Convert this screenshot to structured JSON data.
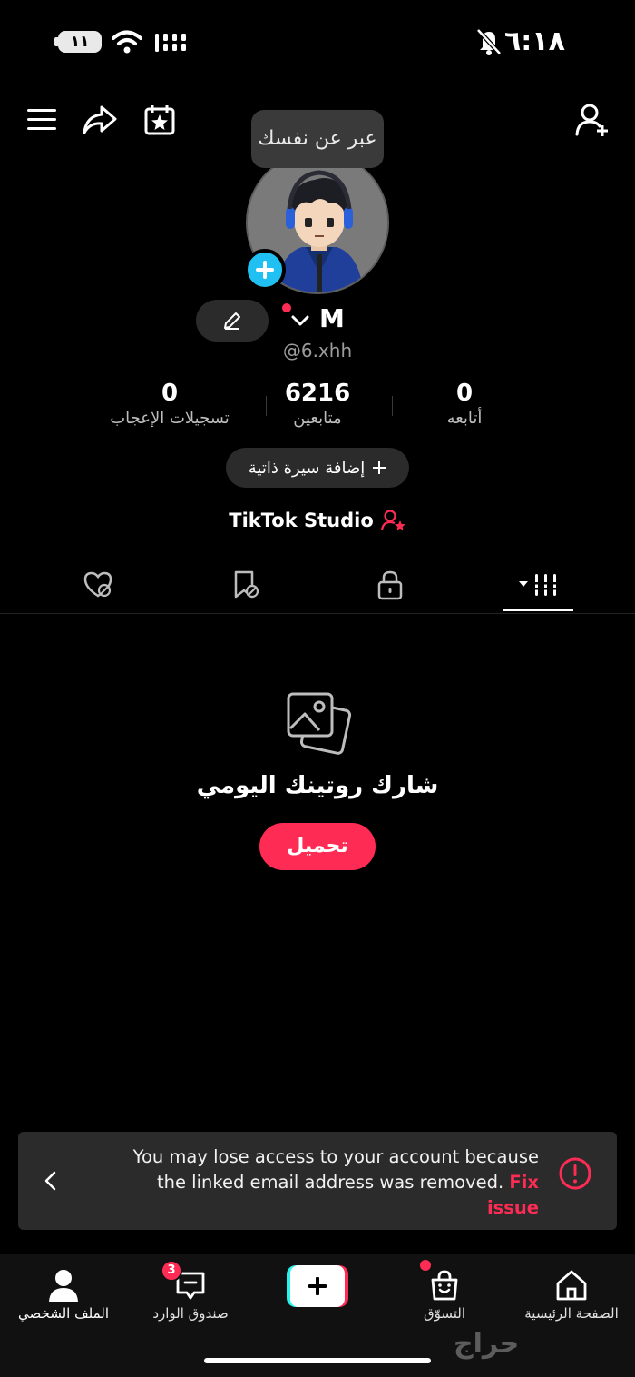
{
  "status_bar": {
    "battery": "١١",
    "time": "٦:١٨"
  },
  "tooltip": "عبر عن نفسك",
  "profile": {
    "display_name": "M",
    "username": "@6.xhh"
  },
  "stats": {
    "likes": {
      "value": "0",
      "label": "تسجيلات الإعجاب"
    },
    "followers": {
      "value": "6216",
      "label": "متابعين"
    },
    "following": {
      "value": "0",
      "label": "أتابعه"
    }
  },
  "bio_button": "إضافة سيرة ذاتية",
  "studio_label": "TikTok Studio",
  "empty_state": {
    "title": "شارك روتينك اليومي",
    "upload_button": "تحميل"
  },
  "banner": {
    "message": "You may lose access to your account because the linked email address was removed.",
    "link": "Fix issue"
  },
  "nav": {
    "profile": "الملف الشخصي",
    "inbox": "صندوق الوارد",
    "inbox_badge": "3",
    "shop": "التسوّق",
    "home": "الصفحة الرئيسية"
  },
  "watermark": "حراج",
  "colors": {
    "accent": "#fe2c55",
    "cyan": "#25f4ee",
    "add_avatar": "#20c0f2"
  }
}
